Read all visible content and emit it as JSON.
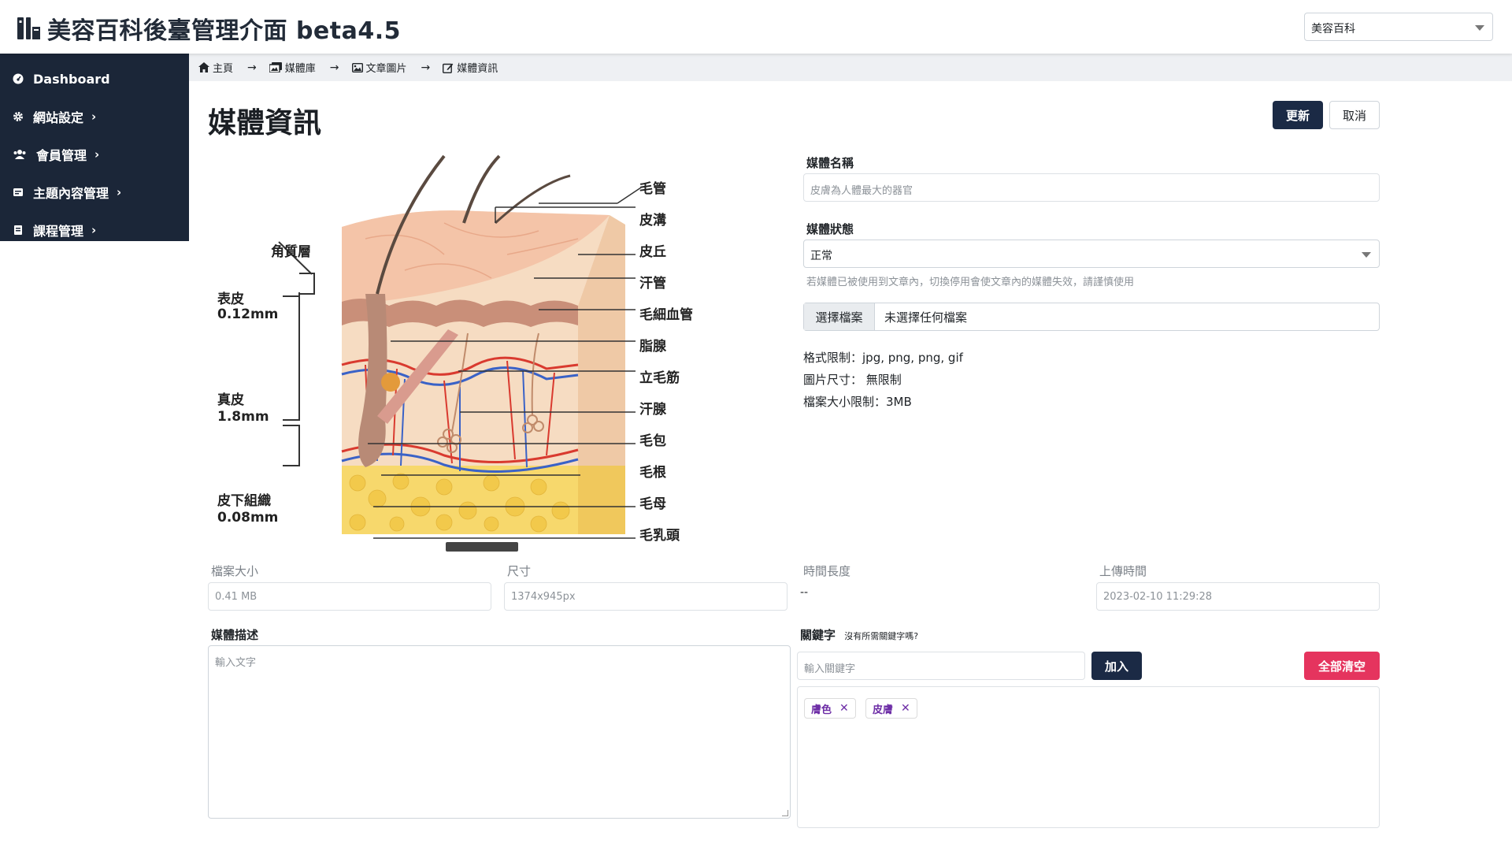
{
  "app": {
    "title": "美容百科後臺管理介面 beta4.5",
    "site_select": "美容百科"
  },
  "sidebar": {
    "items": [
      {
        "label": "Dashboard"
      },
      {
        "label": "網站設定"
      },
      {
        "label": "會員管理"
      },
      {
        "label": "主題內容管理"
      },
      {
        "label": "課程管理"
      }
    ]
  },
  "breadcrumb": [
    "主頁",
    "媒體庫",
    "文章圖片",
    "媒體資訊"
  ],
  "page": {
    "title": "媒體資訊",
    "update_label": "更新",
    "cancel_label": "取消"
  },
  "image": {
    "left_labels": [
      {
        "name": "角質層"
      },
      {
        "name": "表皮",
        "value": "0.12mm"
      },
      {
        "name": "真皮",
        "value": "1.8mm"
      },
      {
        "name": "皮下組織",
        "value": "0.08mm"
      }
    ],
    "right_labels": [
      "毛管",
      "皮溝",
      "皮丘",
      "汗管",
      "毛細血管",
      "脂腺",
      "立毛筋",
      "汗腺",
      "毛包",
      "毛根",
      "毛母",
      "毛乳頭"
    ]
  },
  "form": {
    "media_name_label": "媒體名稱",
    "media_name_placeholder": "皮膚為人體最大的器官",
    "status_label": "媒體狀態",
    "status_value": "正常",
    "status_hint": "若媒體已被使用到文章內，切換停用會使文章內的媒體失效，請謹慎使用",
    "file_button": "選擇檔案",
    "file_name": "未選擇任何檔案",
    "format_limit": "格式限制：jpg, png, png, gif",
    "image_size": "圖片尺寸： 無限制",
    "file_size_limit": "檔案大小限制：3MB",
    "file_size_label": "檔案大小",
    "file_size_value": "0.41 MB",
    "dimension_label": "尺寸",
    "dimension_value": "1374x945px",
    "duration_label": "時間長度",
    "duration_value": "--",
    "upload_time_label": "上傳時間",
    "upload_time_value": "2023-02-10 11:29:28",
    "description_label": "媒體描述",
    "description_placeholder": "輸入文字",
    "keywords_label": "關鍵字",
    "keywords_sub": "沒有所需關鍵字嗎?",
    "keyword_placeholder": "輸入關鍵字",
    "add_label": "加入",
    "clear_label": "全部清空",
    "tags": [
      "膚色",
      "皮膚"
    ]
  },
  "colors": {
    "sidebar_bg": "#1b2638",
    "primary": "#1b2a45",
    "danger": "#e5345e",
    "tag_text": "#6d2da6"
  }
}
